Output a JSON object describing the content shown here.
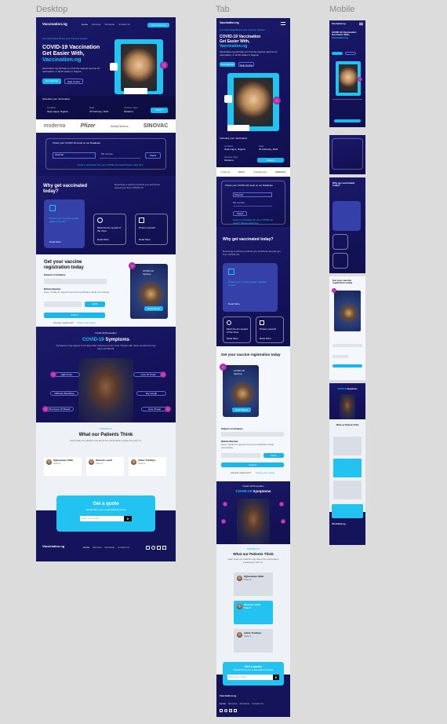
{
  "labels": {
    "desktop": "Desktop",
    "tab": "Tab",
    "mobile": "Mobile"
  },
  "brand": "Vaccination.ng",
  "nav": [
    "Home",
    "Services",
    "Schedule",
    "Contact Us"
  ],
  "cta_header": "Find A Vaccine",
  "hero": {
    "eyebrow": "Get Vaccinated Boost your Immune System",
    "title1": "COVID-19 Vaccination",
    "title2": "Get Easier With,",
    "title3": "Vaccination.ng",
    "body": "Vaccination.ng will help you find the nearest vaccine for vaccination, in all 36 states in Nigeria.",
    "btn_primary": "Get Vaccine",
    "btn_secondary": "Help Centre"
  },
  "schedule": {
    "title": "Schedule your Vaccination",
    "location_label": "Location",
    "location_value": "Ikeja Lagos, Nigeria",
    "date_label": "Date",
    "date_value": "20 February, 2022",
    "type_label": "Vaccine Type",
    "type_value": "Moderna",
    "submit": "Submit"
  },
  "partners": [
    "moderna",
    "Pfizer",
    "AstraZeneca",
    "SINOVAC"
  ],
  "check": {
    "title": "Check your COVID-19 result on our Database",
    "placeholder1": "Chemist",
    "placeholder2": "BN number",
    "button": "Check",
    "note": "Need a verification for your COVID-19 result? Please click here"
  },
  "why": {
    "title": "Why get vaccinated today?",
    "desc": "Receiving a vaccine protects you and those around you from COVID-19.",
    "cards": [
      {
        "title": "Protect your immune system against viruses",
        "link": "Read More"
      },
      {
        "title": "Minimize the spread of the Virus",
        "link": "Read More"
      },
      {
        "title": "Protect yourself",
        "link": "Read More"
      }
    ]
  },
  "register": {
    "title": "Get your vaccine registration today",
    "name_label": "Patient's Full Name",
    "mobile_label": "Mobile Number",
    "mobile_hint": "Enter mobile for appointment and verification while vaccinating",
    "verify": "Verify",
    "submit": "Submit",
    "footer_q": "Already registered?",
    "footer_link": "Check your status",
    "photo_caption": "COVID-19 Vaccine",
    "photo_btn": "Read Below"
  },
  "symptoms": {
    "eyebrow": "Covid-19 Prevention",
    "title_a": "COVID-19",
    "title_b": "Symptoms",
    "desc": "Symptoms may appear 2-14 days after exposure to the virus. People with these symptoms may have COVID-19.",
    "items": [
      "High Fever",
      "Loss Of Smell",
      "Difficulty Breathing",
      "Dry Cough",
      "Shortness Of Breath",
      "Sore Throat"
    ]
  },
  "testimonials": {
    "eyebrow": "FEEDBACK",
    "title": "What our Patients Think",
    "desc": "Hear what our patients say about the vaccination experience with us.",
    "people": [
      {
        "name": "Oghenekaro Mabi",
        "role": "Patient"
      },
      {
        "name": "Oluwole Lawal",
        "role": "Patient"
      },
      {
        "name": "Adetu Tomilayo",
        "role": "Patient"
      }
    ]
  },
  "quote": {
    "title": "Get a quote",
    "desc": "Please fill in your email address below",
    "placeholder": "Enter your email"
  },
  "footer": {
    "links": [
      "Home",
      "Services",
      "Schedule",
      "Contact Us"
    ]
  }
}
